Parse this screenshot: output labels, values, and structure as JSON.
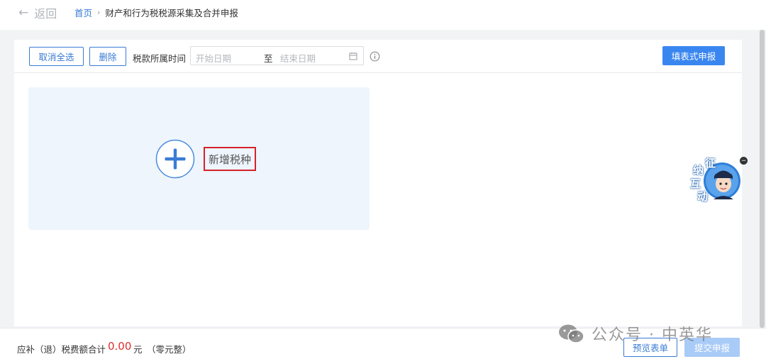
{
  "header": {
    "back_label": "返回",
    "breadcrumb_home": "首页",
    "breadcrumb_current": "财产和行为税税源采集及合并申报"
  },
  "toolbar": {
    "cancel_all_label": "取消全选",
    "delete_label": "删除",
    "period_label": "税款所属时间",
    "start_placeholder": "开始日期",
    "range_separator": "至",
    "end_placeholder": "结束日期",
    "form_declare_label": "填表式申报"
  },
  "main": {
    "add_tax_label": "新增税种"
  },
  "floater": {
    "chars": [
      "征",
      "纳",
      "互",
      "动"
    ]
  },
  "footer": {
    "total_label": "应补（退）税费额合计",
    "amount": "0.00",
    "unit": "元",
    "amount_words": "（零元整）",
    "preview_label": "预览表单",
    "submit_label": "提交申报"
  },
  "watermark": {
    "text": "公众号 · 中英华"
  },
  "colors": {
    "primary": "#3a86f0",
    "link": "#3a7bd5",
    "amount_red": "#e02d2d",
    "highlight_border": "#d6222a",
    "panel_bg": "#eef5fc"
  }
}
